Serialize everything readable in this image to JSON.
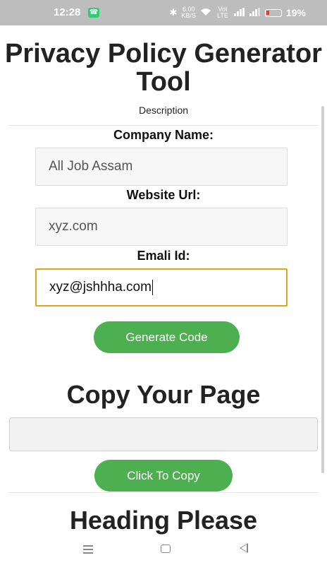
{
  "status_bar": {
    "time": "12:28",
    "speed_value": "6.00",
    "speed_unit": "KB/S",
    "volte": "VoI LTE",
    "battery_pct": "19%",
    "battery_color": "#e53935",
    "icons": [
      "call-icon",
      "bluetooth-icon",
      "wifi-icon",
      "signal-icon",
      "battery-icon"
    ]
  },
  "page": {
    "title": "Privacy Policy Generator Tool",
    "description": "Description",
    "company_label": "Company Name:",
    "company_value": "All Job Assam",
    "website_label": "Website Url:",
    "website_value": "xyz.com",
    "email_label": "Emali Id:",
    "email_value": "xyz@jshhha.com",
    "generate_button": "Generate Code",
    "copy_heading": "Copy Your Page",
    "copy_output": "",
    "copy_button": "Click To Copy",
    "next_heading": "Heading Please",
    "accent_color": "#4caf50",
    "focus_color": "#e0a320"
  },
  "nav_bar": {
    "icons": [
      "menu-icon",
      "home-icon",
      "back-icon"
    ]
  }
}
